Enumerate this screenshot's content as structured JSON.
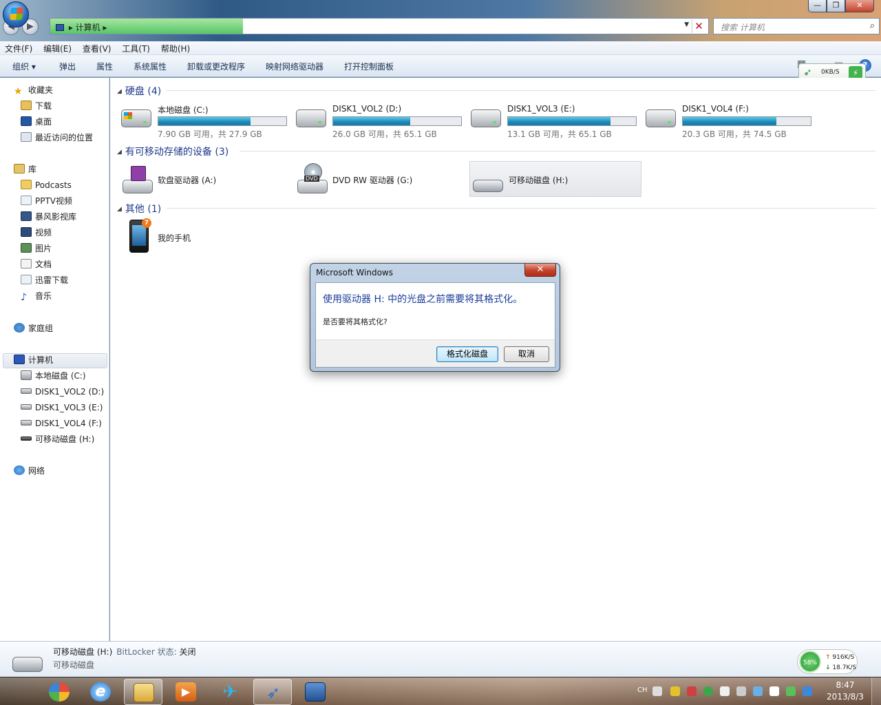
{
  "window": {
    "controls": {
      "minimize": "—",
      "maximize": "❐",
      "close": "✕"
    },
    "address": {
      "location": "计算机",
      "dropdown": "▼",
      "clear": "✕"
    },
    "search": {
      "placeholder": "搜索 计算机",
      "icon": "search-icon"
    }
  },
  "menu": [
    "文件(F)",
    "编辑(E)",
    "查看(V)",
    "工具(T)",
    "帮助(H)"
  ],
  "commands": [
    "组织 ▾",
    "弹出",
    "属性",
    "系统属性",
    "卸载或更改程序",
    "映射网络驱动器",
    "打开控制面板"
  ],
  "speed_widget": {
    "speed": "0KB/S",
    "bolt": "⚡"
  },
  "help": "?",
  "nav": {
    "favorites": {
      "label": "收藏夹",
      "items": [
        "下载",
        "桌面",
        "最近访问的位置"
      ]
    },
    "libraries": {
      "label": "库",
      "items": [
        "Podcasts",
        "PPTV视频",
        "暴风影视库",
        "视频",
        "图片",
        "文档",
        "迅雷下载",
        "音乐"
      ]
    },
    "homegroup": "家庭组",
    "computer": {
      "label": "计算机",
      "items": [
        "本地磁盘 (C:)",
        "DISK1_VOL2 (D:)",
        "DISK1_VOL3 (E:)",
        "DISK1_VOL4 (F:)",
        "可移动磁盘 (H:)"
      ]
    },
    "network": "网络"
  },
  "groups": {
    "hdd": "硬盘 (4)",
    "removable": "有可移动存储的设备 (3)",
    "other": "其他 (1)"
  },
  "drives": [
    {
      "name": "本地磁盘 (C:)",
      "free": "7.90 GB 可用，共 27.9 GB",
      "used_fraction": 0.72
    },
    {
      "name": "DISK1_VOL2 (D:)",
      "free": "26.0 GB 可用，共 65.1 GB",
      "used_fraction": 0.6
    },
    {
      "name": "DISK1_VOL3 (E:)",
      "free": "13.1 GB 可用，共 65.1 GB",
      "used_fraction": 0.8
    },
    {
      "name": "DISK1_VOL4 (F:)",
      "free": "20.3 GB 可用，共 74.5 GB",
      "used_fraction": 0.73
    }
  ],
  "devices": [
    "软盘驱动器 (A:)",
    "DVD RW 驱动器 (G:)",
    "可移动磁盘 (H:)"
  ],
  "dvd_badge": "DVD",
  "other": {
    "phone": "我的手机",
    "badge": "7"
  },
  "details": {
    "name": "可移动磁盘 (H:)",
    "bitlocker_label": "BitLocker 状态:",
    "bitlocker_value": "关闭",
    "type": "可移动磁盘"
  },
  "netmeter": {
    "percent": "58%",
    "up": "916K/S",
    "down": "18.7K/S",
    "up_arrow": "↑",
    "down_arrow": "↓"
  },
  "tray": {
    "lang": "CH",
    "time": "8:47",
    "date": "2013/8/3"
  },
  "dialog": {
    "title": "Microsoft Windows",
    "close": "✕",
    "main": "使用驱动器 H: 中的光盘之前需要将其格式化。",
    "sub": "是否要将其格式化?",
    "format_button": "格式化磁盘",
    "cancel_button": "取消"
  }
}
